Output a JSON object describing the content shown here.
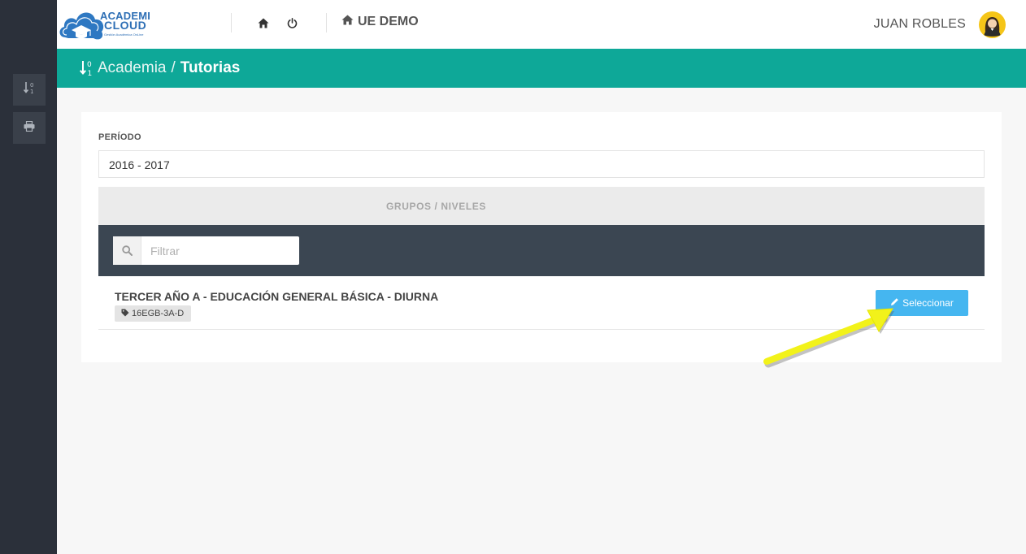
{
  "colors": {
    "sidebar": "#2b303a",
    "sidebar_button": "#3a404a",
    "teal_bar": "#0ea898",
    "filter_bar": "#3b4652",
    "select_button": "#45b6f0",
    "arrow": "#f2f21a"
  },
  "logo": {
    "line1": "ACADEMI",
    "line2": "CLOUD",
    "tagline": "Gestión Académica OnLine"
  },
  "topbar": {
    "home_icon": "home-icon",
    "power_icon": "power-icon",
    "school_icon": "home-icon",
    "school_name": "UE DEMO",
    "user_name": "JUAN ROBLES",
    "avatar_icon": "user-avatar"
  },
  "sidebar": {
    "items": [
      {
        "icon": "sort-numeric-icon"
      },
      {
        "icon": "print-icon"
      }
    ]
  },
  "breadcrumb": {
    "icon": "sort-numeric-icon",
    "parent": "Academia",
    "separator": "/",
    "current": "Tutorias"
  },
  "form": {
    "period_label": "PERÍODO",
    "period_value": "2016 - 2017",
    "groups_header": "GRUPOS / NIVELES",
    "filter_placeholder": "Filtrar",
    "filter_icon": "search-icon"
  },
  "groups": [
    {
      "title": "TERCER AÑO A - EDUCACIÓN GENERAL BÁSICA - DIURNA",
      "tag_icon": "tag-icon",
      "code": "16EGB-3A-D",
      "button_icon": "pencil-icon",
      "button_label": "Seleccionar"
    }
  ],
  "annotation": {
    "type": "arrow pointing to Seleccionar button"
  }
}
